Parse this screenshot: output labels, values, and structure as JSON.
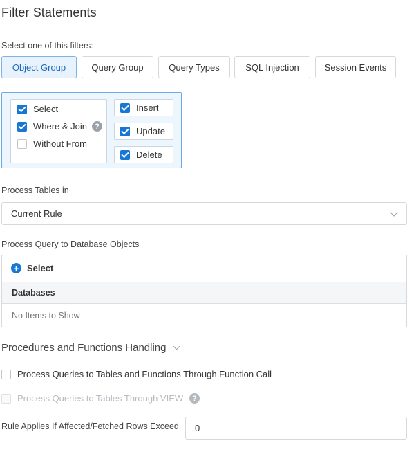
{
  "page": {
    "title": "Filter Statements"
  },
  "filters": {
    "prompt": "Select one of this filters:",
    "tabs": [
      {
        "label": "Object Group",
        "active": true
      },
      {
        "label": "Query Group",
        "active": false
      },
      {
        "label": "Query Types",
        "active": false
      },
      {
        "label": "SQL Injection",
        "active": false
      },
      {
        "label": "Session Events",
        "active": false
      }
    ]
  },
  "object_group": {
    "left": [
      {
        "label": "Select",
        "checked": true
      },
      {
        "label": "Where & Join",
        "checked": true,
        "help_icon": "question-icon"
      },
      {
        "label": "Without From",
        "checked": false
      }
    ],
    "right": [
      {
        "label": "Insert",
        "checked": true
      },
      {
        "label": "Update",
        "checked": true
      },
      {
        "label": "Delete",
        "checked": true
      }
    ]
  },
  "process_tables": {
    "label": "Process Tables in",
    "value": "Current Rule"
  },
  "process_query": {
    "label": "Process Query to Database Objects",
    "select_label": "Select",
    "column_header": "Databases",
    "empty_text": "No Items to Show"
  },
  "procedures": {
    "title": "Procedures and Functions Handling",
    "options": [
      {
        "label": "Process Queries to Tables and Functions Through Function Call",
        "checked": false,
        "disabled": false
      },
      {
        "label": "Process Queries to Tables Through VIEW",
        "checked": false,
        "disabled": true
      }
    ]
  },
  "rows_exceed": {
    "label": "Rule Applies If Affected/Fetched Rows Exceed",
    "value": "0"
  },
  "colors": {
    "accent": "#1877d2",
    "active_tab_bg": "#e7f2fc",
    "group_border": "#6aaae6"
  }
}
